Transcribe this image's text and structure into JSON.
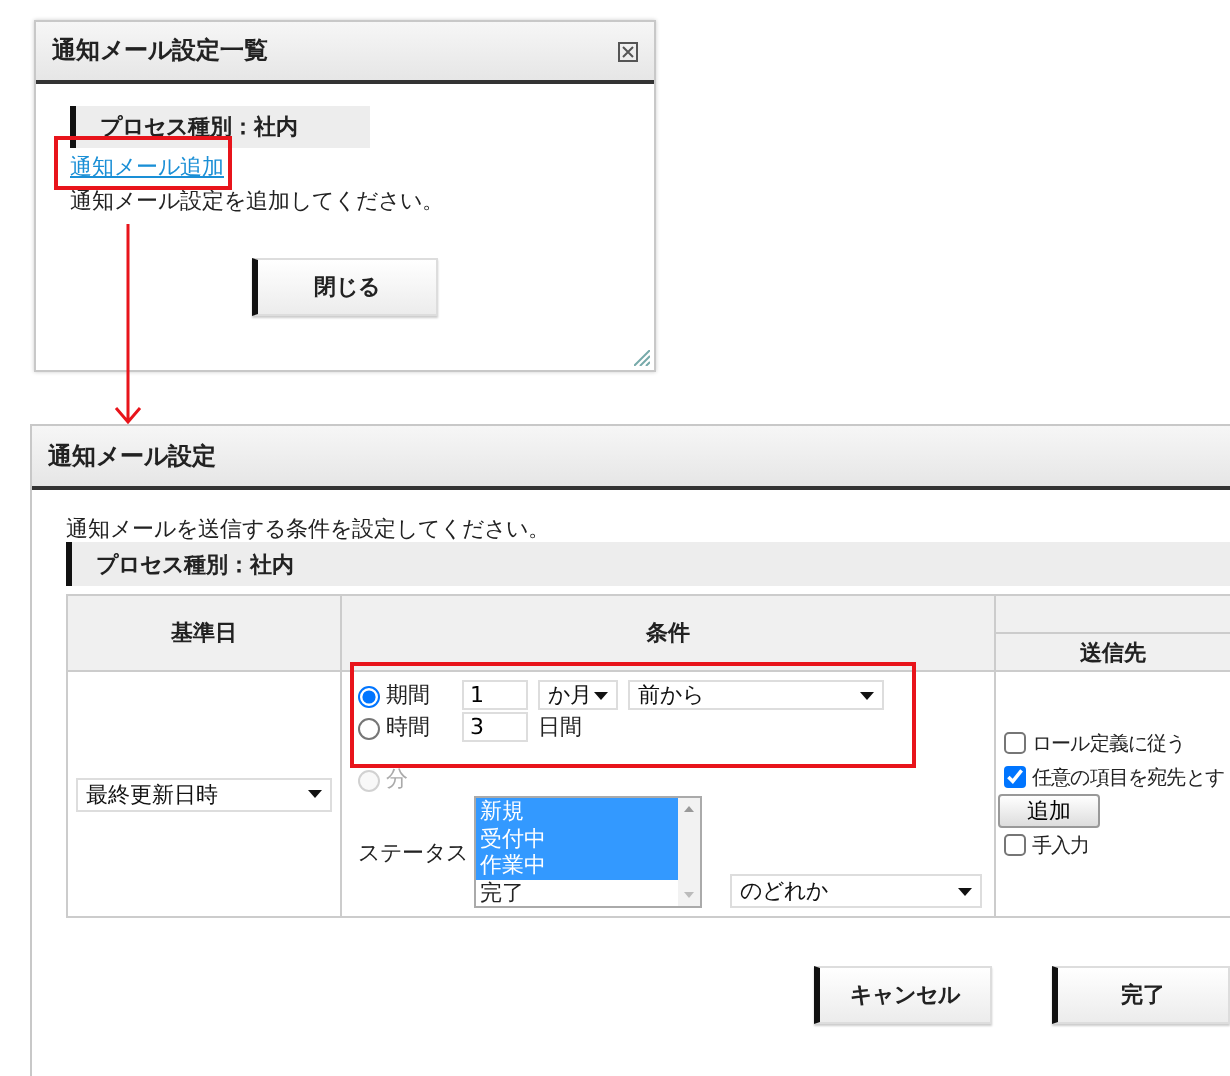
{
  "list_dialog": {
    "title": "通知メール設定一覧",
    "section_header": "プロセス種別：社内",
    "add_link": "通知メール追加",
    "hint": "通知メール設定を追加してください。",
    "close_button": "閉じる"
  },
  "settings_dialog": {
    "title": "通知メール設定",
    "instruction": "通知メールを送信する条件を設定してください。",
    "section_header": "プロセス種別：社内",
    "table": {
      "columns": [
        "基準日",
        "条件",
        "送信先"
      ],
      "base_date": {
        "value": "最終更新日時"
      },
      "condition": {
        "modes": [
          {
            "label": "期間",
            "selected": true,
            "disabled": false
          },
          {
            "label": "時間",
            "selected": false,
            "disabled": false
          },
          {
            "label": "分",
            "selected": false,
            "disabled": true
          }
        ],
        "amount": "1",
        "unit": "か月",
        "direction": "前から",
        "days": "3",
        "days_unit": "日間",
        "status_label": "ステータス",
        "statuses": [
          {
            "label": "新規",
            "selected": true
          },
          {
            "label": "受付中",
            "selected": true
          },
          {
            "label": "作業中",
            "selected": true
          },
          {
            "label": "完了",
            "selected": false
          }
        ],
        "match": "のどれか"
      },
      "recipients": [
        {
          "kind": "checkbox",
          "label": "ロール定義に従う",
          "checked": false
        },
        {
          "kind": "checkbox",
          "label": "任意の項目を宛先とす",
          "checked": true
        },
        {
          "kind": "button",
          "label": "追加"
        },
        {
          "kind": "checkbox",
          "label": "手入力",
          "checked": false
        }
      ]
    },
    "buttons": [
      "キャンセル",
      "完了"
    ]
  }
}
